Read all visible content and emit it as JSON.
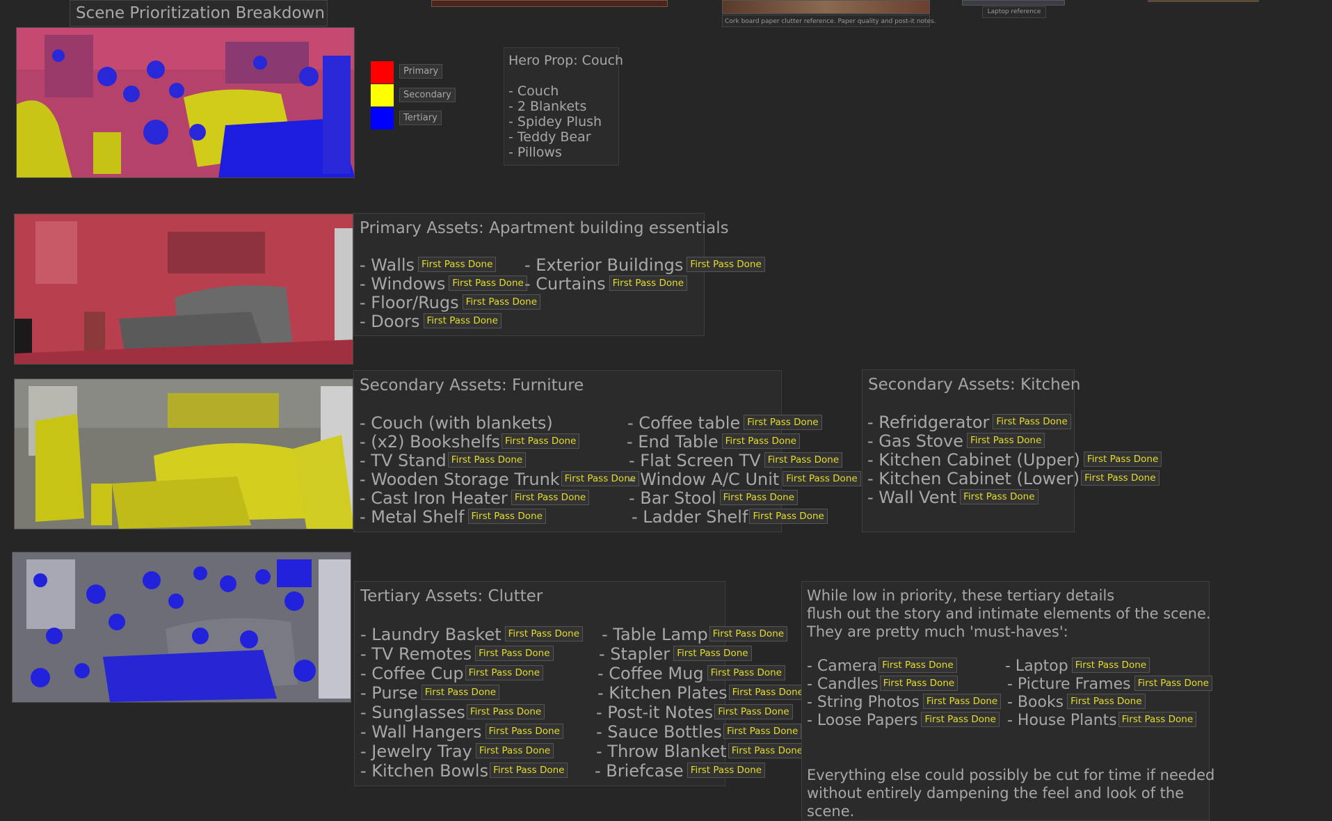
{
  "page_title": "Scene Prioritization Breakdown",
  "reference_captions": {
    "corkboard": "Cork board paper clutter reference. Paper quality and post-it notes.",
    "laptop": "Laptop reference"
  },
  "legend": [
    {
      "label": "Primary",
      "color": "#ff0000"
    },
    {
      "label": "Secondary",
      "color": "#ffff00"
    },
    {
      "label": "Tertiary",
      "color": "#0000ff"
    }
  ],
  "hero": {
    "title": "Hero Prop: Couch",
    "items": [
      "- Couch",
      "- 2 Blankets",
      "- Spidey Plush",
      "- Teddy Bear",
      "- Pillows"
    ]
  },
  "status_label": "First Pass Done",
  "primary": {
    "title": "Primary Assets: Apartment building essentials",
    "col1": [
      "- Walls",
      "- Windows",
      "- Floor/Rugs",
      "- Doors"
    ],
    "col2": [
      "- Exterior Buildings",
      "- Curtains"
    ]
  },
  "secondary_furniture": {
    "title": "Secondary Assets: Furniture",
    "col1": [
      "- Couch (with blankets)",
      "- (x2) Bookshelfs",
      "- TV Stand",
      "- Wooden Storage Trunk",
      "- Cast Iron Heater",
      "- Metal Shelf"
    ],
    "col2": [
      "- Coffee table",
      "- End Table",
      "- Flat Screen TV",
      "- Window A/C Unit",
      "- Bar Stool",
      "- Ladder Shelf"
    ]
  },
  "secondary_kitchen": {
    "title": "Secondary Assets: Kitchen",
    "items": [
      "- Refridgerator",
      "- Gas Stove",
      "- Kitchen Cabinet (Upper)",
      "- Kitchen Cabinet (Lower)",
      "- Wall Vent"
    ]
  },
  "tertiary": {
    "title": "Tertiary Assets: Clutter",
    "col1": [
      "- Laundry Basket",
      "- TV Remotes",
      "- Coffee Cup",
      "- Purse",
      "- Sunglasses",
      "- Wall Hangers",
      "- Jewelry Tray",
      "- Kitchen Bowls"
    ],
    "col2": [
      "- Table Lamp",
      "- Stapler",
      "- Coffee Mug",
      "- Kitchen Plates",
      "- Post-it Notes",
      "- Sauce Bottles",
      "- Throw Blanket",
      "- Briefcase"
    ]
  },
  "tertiary_note": {
    "intro_lines": [
      "While low in priority, these tertiary details",
      "flush out the story and intimate elements of the scene.",
      "They are pretty much 'must-haves':"
    ],
    "col1": [
      "- Camera",
      "- Candles",
      "- String Photos",
      "- Loose Papers"
    ],
    "col2": [
      "- Laptop",
      "- Picture Frames",
      "- Books",
      "- House Plants"
    ],
    "outro_lines": [
      "Everything else could possibly be cut for time if needed",
      "without entirely dampening the feel and look of the",
      "scene."
    ]
  }
}
